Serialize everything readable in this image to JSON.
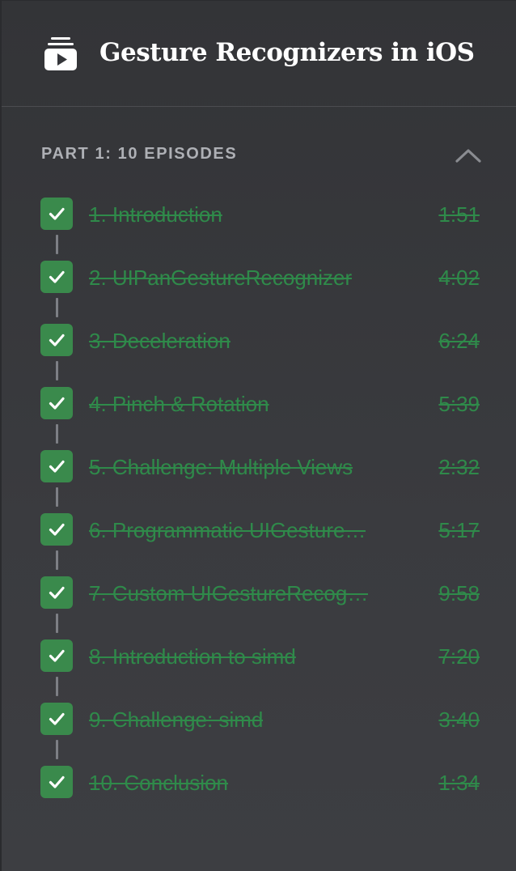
{
  "course": {
    "title": "Gesture Recognizers in iOS",
    "icon": "video-playlist-icon"
  },
  "part": {
    "label": "PART 1: 10 EPISODES",
    "expanded": true,
    "toggle_icon": "chevron-up-icon"
  },
  "colors": {
    "completed": "#3a8a4c",
    "completed_text": "#2f8a4a",
    "connector": "#7d7f85"
  },
  "episodes": [
    {
      "title": "1. Introduction",
      "duration": "1:51",
      "completed": true
    },
    {
      "title": "2. UIPanGestureRecognizer",
      "duration": "4:02",
      "completed": true
    },
    {
      "title": "3. Deceleration",
      "duration": "6:24",
      "completed": true
    },
    {
      "title": "4. Pinch & Rotation",
      "duration": "5:39",
      "completed": true
    },
    {
      "title": "5. Challenge: Multiple Views",
      "duration": "2:32",
      "completed": true
    },
    {
      "title": "6. Programmatic UIGesture…",
      "duration": "5:17",
      "completed": true
    },
    {
      "title": "7. Custom UIGestureRecog…",
      "duration": "9:58",
      "completed": true
    },
    {
      "title": "8. Introduction to simd",
      "duration": "7:20",
      "completed": true
    },
    {
      "title": "9. Challenge: simd",
      "duration": "3:40",
      "completed": true
    },
    {
      "title": "10. Conclusion",
      "duration": "1:34",
      "completed": true
    }
  ]
}
